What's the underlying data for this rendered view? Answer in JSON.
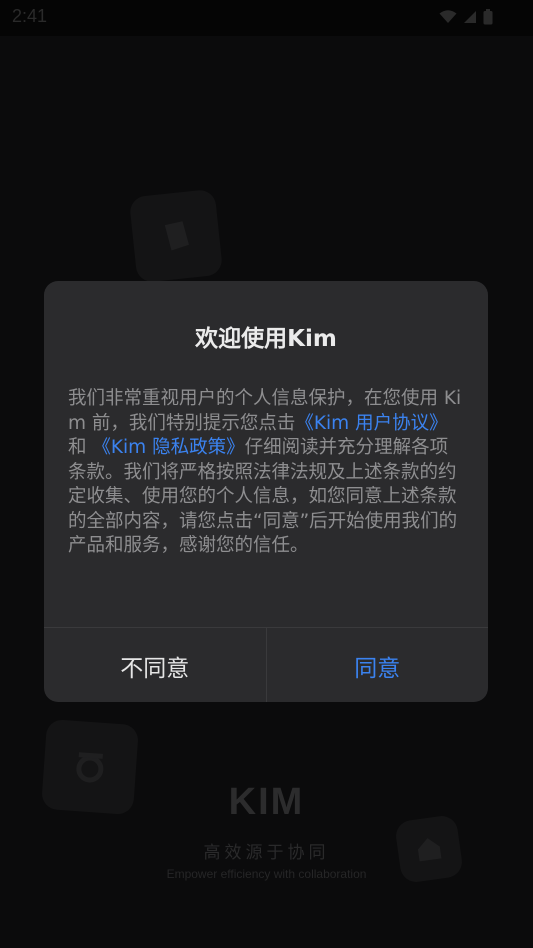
{
  "status_bar": {
    "time": "2:41",
    "icons": [
      "wifi-icon",
      "signal-icon",
      "battery-icon"
    ]
  },
  "background": {
    "logo_text": "KIM",
    "slogan": "高效源于协同",
    "subtitle": "Empower efficiency with collaboration"
  },
  "dialog": {
    "title": "欢迎使用Kim",
    "body": {
      "text_1": "我们非常重视用户的个人信息保护，在您使用 Kim 前，我们特别提示您点击",
      "link_user_agreement": "《Kim 用户协议》",
      "text_and": " 和 ",
      "link_privacy_policy": "《Kim 隐私政策》",
      "text_2": "仔细阅读并充分理解各项条款。我们将严格按照法律法规及上述条款的约定收集、使用您的个人信息，如您同意上述条款的全部内容，请您点击“同意”后开始使用我们的产品和服务，感谢您的信任。"
    },
    "disagree_label": "不同意",
    "agree_label": "同意"
  },
  "colors": {
    "accent": "#3b83f0",
    "dialog_bg": "#2b2b2d",
    "body_text": "#8e8e90"
  }
}
